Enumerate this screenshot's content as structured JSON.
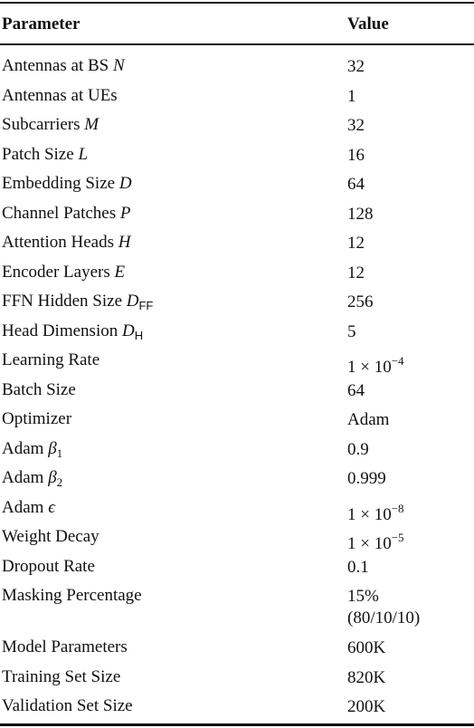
{
  "table": {
    "headers": {
      "parameter": "Parameter",
      "value": "Value"
    },
    "rows": [
      {
        "label": "Antennas at BS ",
        "sym": "N",
        "sub": "",
        "value": "32"
      },
      {
        "label": "Antennas at UEs",
        "sym": "",
        "sub": "",
        "value": "1"
      },
      {
        "label": "Subcarriers ",
        "sym": "M",
        "sub": "",
        "value": "32"
      },
      {
        "label": "Patch Size ",
        "sym": "L",
        "sub": "",
        "value": "16"
      },
      {
        "label": "Embedding Size ",
        "sym": "D",
        "sub": "",
        "value": "64"
      },
      {
        "label": "Channel Patches ",
        "sym": "P",
        "sub": "",
        "value": "128"
      },
      {
        "label": "Attention Heads ",
        "sym": "H",
        "sub": "",
        "value": "12"
      },
      {
        "label": "Encoder Layers ",
        "sym": "E",
        "sub": "",
        "value": "12"
      },
      {
        "label": "FFN Hidden Size ",
        "sym": "D",
        "sub": "FF",
        "value": "256"
      },
      {
        "label": "Head Dimension ",
        "sym": "D",
        "sub": "H",
        "value": "5"
      },
      {
        "label": "Learning Rate",
        "sym": "",
        "sub": "",
        "value": "1 × 10",
        "exp": "−4"
      },
      {
        "label": "Batch Size",
        "sym": "",
        "sub": "",
        "value": "64"
      },
      {
        "label": "Optimizer",
        "sym": "",
        "sub": "",
        "value": "Adam"
      },
      {
        "label": "Adam ",
        "sym": "β",
        "numsub": "1",
        "value": "0.9"
      },
      {
        "label": "Adam ",
        "sym": "β",
        "numsub": "2",
        "value": "0.999"
      },
      {
        "label": "Adam ",
        "sym": "ϵ",
        "sub": "",
        "value": "1 × 10",
        "exp": "−8"
      },
      {
        "label": "Weight Decay",
        "sym": "",
        "sub": "",
        "value": "1 × 10",
        "exp": "−5"
      },
      {
        "label": "Dropout Rate",
        "sym": "",
        "sub": "",
        "value": "0.1"
      },
      {
        "label": "Masking Percentage",
        "sym": "",
        "sub": "",
        "value": "15%",
        "value2": "(80/10/10)"
      },
      {
        "label": "Model Parameters",
        "sym": "",
        "sub": "",
        "value": "600K"
      },
      {
        "label": "Training Set Size",
        "sym": "",
        "sub": "",
        "value": "820K"
      },
      {
        "label": "Validation Set Size",
        "sym": "",
        "sub": "",
        "value": "200K"
      }
    ]
  }
}
